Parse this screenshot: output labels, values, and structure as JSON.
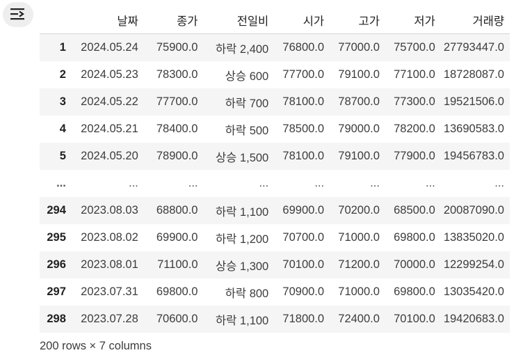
{
  "toolbar": {
    "toggle_icon": "format-list-icon"
  },
  "table": {
    "index_header": "",
    "columns": [
      "날짜",
      "종가",
      "전일비",
      "시가",
      "고가",
      "저가",
      "거래량"
    ],
    "rows": [
      {
        "index": "1",
        "cells": [
          "2024.05.24",
          "75900.0",
          "하락 2,400",
          "76800.0",
          "77000.0",
          "75700.0",
          "27793447.0"
        ]
      },
      {
        "index": "2",
        "cells": [
          "2024.05.23",
          "78300.0",
          "상승 600",
          "77700.0",
          "79100.0",
          "77100.0",
          "18728087.0"
        ]
      },
      {
        "index": "3",
        "cells": [
          "2024.05.22",
          "77700.0",
          "하락 700",
          "78100.0",
          "78700.0",
          "77300.0",
          "19521506.0"
        ]
      },
      {
        "index": "4",
        "cells": [
          "2024.05.21",
          "78400.0",
          "하락 500",
          "78500.0",
          "79000.0",
          "78200.0",
          "13690583.0"
        ]
      },
      {
        "index": "5",
        "cells": [
          "2024.05.20",
          "78900.0",
          "상승 1,500",
          "78100.0",
          "79100.0",
          "77900.0",
          "19456783.0"
        ]
      },
      {
        "index": "...",
        "cells": [
          "...",
          "...",
          "...",
          "...",
          "...",
          "...",
          "..."
        ]
      },
      {
        "index": "294",
        "cells": [
          "2023.08.03",
          "68800.0",
          "하락 1,100",
          "69900.0",
          "70200.0",
          "68500.0",
          "20087090.0"
        ]
      },
      {
        "index": "295",
        "cells": [
          "2023.08.02",
          "69900.0",
          "하락 1,200",
          "70700.0",
          "71000.0",
          "69800.0",
          "13835020.0"
        ]
      },
      {
        "index": "296",
        "cells": [
          "2023.08.01",
          "71100.0",
          "상승 1,300",
          "70100.0",
          "71200.0",
          "70000.0",
          "12299254.0"
        ]
      },
      {
        "index": "297",
        "cells": [
          "2023.07.31",
          "69800.0",
          "하락 800",
          "70900.0",
          "71000.0",
          "69800.0",
          "13035420.0"
        ]
      },
      {
        "index": "298",
        "cells": [
          "2023.07.28",
          "70600.0",
          "하락 1,100",
          "71800.0",
          "72400.0",
          "70100.0",
          "19420683.0"
        ]
      }
    ]
  },
  "footer": {
    "summary": "200 rows × 7 columns"
  }
}
